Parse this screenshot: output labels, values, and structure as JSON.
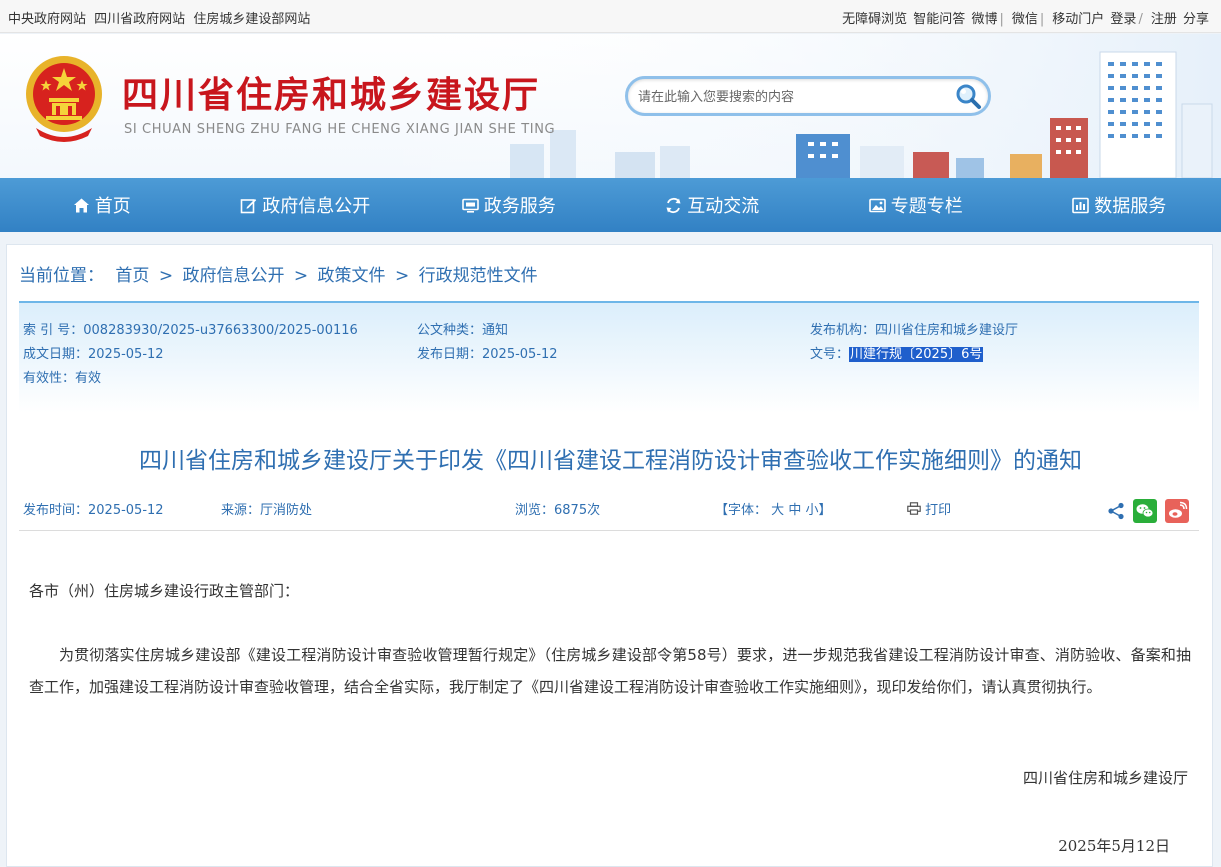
{
  "topbar": {
    "left_links": [
      "中央政府网站",
      "四川省政府网站",
      "住房城乡建设部网站"
    ],
    "right_links": [
      "无障碍浏览",
      "智能问答",
      "微博",
      "微信",
      "移动门户",
      "登录",
      "注册",
      "分享"
    ]
  },
  "header": {
    "title": "四川省住房和城乡建设厅",
    "subtitle": "SI CHUAN SHENG ZHU FANG HE CHENG XIANG JIAN SHE TING",
    "search_placeholder": "请在此输入您要搜索的内容"
  },
  "nav": {
    "items": [
      {
        "label": "首页",
        "icon": "home-icon"
      },
      {
        "label": "政府信息公开",
        "icon": "edit-icon"
      },
      {
        "label": "政务服务",
        "icon": "monitor-icon"
      },
      {
        "label": "互动交流",
        "icon": "exchange-icon"
      },
      {
        "label": "专题专栏",
        "icon": "image-icon"
      },
      {
        "label": "数据服务",
        "icon": "chart-icon"
      }
    ]
  },
  "breadcrumb": {
    "label": "当前位置：",
    "items": [
      "首页",
      "政府信息公开",
      "政策文件",
      "行政规范性文件"
    ]
  },
  "meta": {
    "index_no": "索 引 号：008283930/2025-u37663300/2025-00116",
    "doc_type": "公文种类：通知",
    "issuer": "发布机构：四川省住房和城乡建设厅",
    "created": "成文日期：2025-05-12",
    "published": "发布日期：2025-05-12",
    "doc_no_label": "文号：",
    "doc_no": "川建行规〔2025〕6号",
    "validity": "有效性：有效"
  },
  "article": {
    "title": "四川省住房和城乡建设厅关于印发《四川省建设工程消防设计审查验收工作实施细则》的通知",
    "publish_time": "发布时间：2025-05-12",
    "source": "来源：厅消防处",
    "views": "浏览：6875次",
    "font_label": "【字体：",
    "font_large": "大",
    "font_medium": "中",
    "font_small": "小",
    "font_end": "】",
    "print": "打印",
    "greeting": "各市（州）住房城乡建设行政主管部门：",
    "paragraph": "为贯彻落实住房城乡建设部《建设工程消防设计审查验收管理暂行规定》（住房城乡建设部令第58号）要求，进一步规范我省建设工程消防设计审查、消防验收、备案和抽查工作，加强建设工程消防设计审查验收管理，结合全省实际，我厅制定了《四川省建设工程消防设计审查验收工作实施细则》，现印发给你们，请认真贯彻执行。",
    "signature": "四川省住房和城乡建设厅",
    "date": "2025年5月12日"
  },
  "colors": {
    "brand_red": "#c8161d",
    "nav_blue": "#3f8fcf",
    "link_blue": "#2f6fb1",
    "wechat_green": "#2aae3a",
    "weibo_red": "#e8625a"
  }
}
